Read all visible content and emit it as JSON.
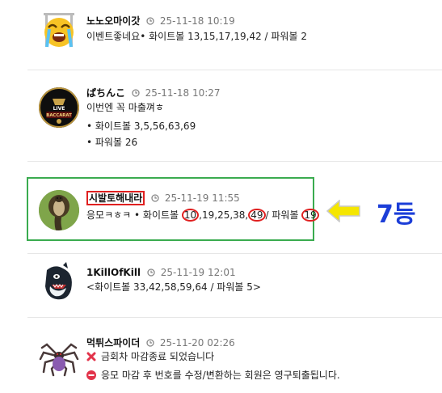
{
  "comments": [
    {
      "nickname": "노노오마이갓",
      "time": "25-11-18 10:19",
      "lines": [
        "이벤트좋네요• 화이트볼 13,15,17,19,42 / 파워볼 2"
      ],
      "avatar": "crying-emoji-avatar"
    },
    {
      "nickname": "ぱちんこ",
      "time": "25-11-18 10:27",
      "lines": [
        "이번엔 꼭 마출껴ㅎ",
        "• 화이트볼 3,5,56,63,69",
        "• 파워볼 26"
      ],
      "avatar": "live-baccarat-avatar",
      "avatar_text": [
        "LIVE",
        "BACCARAT"
      ]
    },
    {
      "nickname": "시발토해내라",
      "time": "25-11-19 11:55",
      "line_parts": [
        "응모ㅋㅎㅋ • 화이트볼 ",
        "10",
        ",19,25,38,",
        "49",
        "/ 파워볼 ",
        "19"
      ],
      "avatar": "cobra-avatar"
    },
    {
      "nickname": "1KillOfKill",
      "time": "25-11-19 12:01",
      "lines": [
        "<화이트볼 33,42,58,59,64 / 파워볼 5>"
      ],
      "avatar": "orca-avatar"
    },
    {
      "nickname": "먹튀스파이더",
      "time": "25-11-20 02:26",
      "lines": [
        "금회차 마감종료 되었습니다",
        "응모 마감 후 번호를 수정/변환하는 회원은 영구퇴출됩니다."
      ],
      "avatar": "spider-avatar",
      "line_icons": [
        "x-mark-icon",
        "no-entry-icon"
      ]
    }
  ],
  "annotation": {
    "rank_label": "7등",
    "arrow": "yellow-left-arrow",
    "colors": {
      "highlight_box": "#3aab4f",
      "circle": "#e02020",
      "rank": "#1c3ed8",
      "arrow": "#f5e600"
    }
  }
}
